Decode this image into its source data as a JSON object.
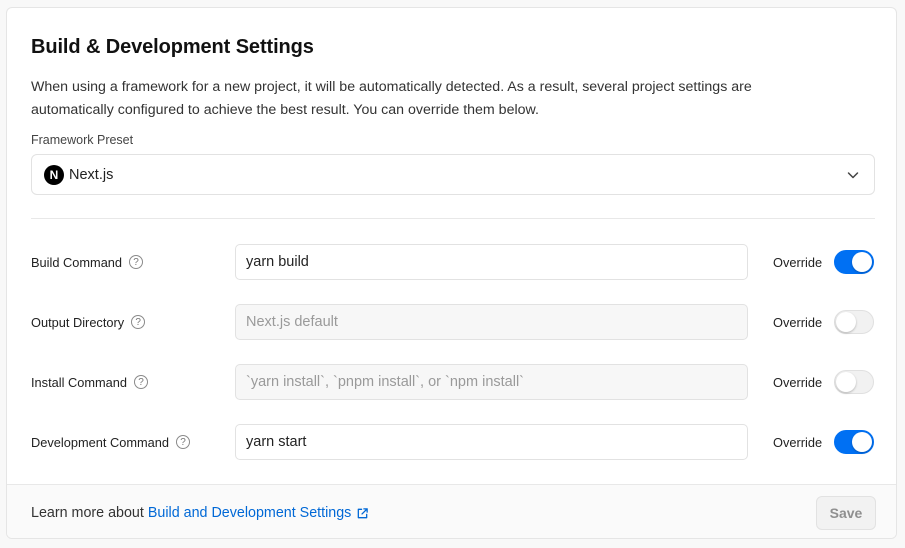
{
  "section": {
    "title": "Build & Development Settings",
    "description": "When using a framework for a new project, it will be automatically detected. As a result, several project settings are automatically configured to achieve the best result. You can override them below."
  },
  "framework": {
    "label": "Framework Preset",
    "selected": "Next.js",
    "logo_letter": "N"
  },
  "settings": [
    {
      "label": "Build Command",
      "value": "yarn build",
      "placeholder": "",
      "override_label": "Override",
      "override": true
    },
    {
      "label": "Output Directory",
      "value": "",
      "placeholder": "Next.js default",
      "override_label": "Override",
      "override": false
    },
    {
      "label": "Install Command",
      "value": "",
      "placeholder": "`yarn install`, `pnpm install`, or `npm install`",
      "override_label": "Override",
      "override": false
    },
    {
      "label": "Development Command",
      "value": "yarn start",
      "placeholder": "",
      "override_label": "Override",
      "override": true
    }
  ],
  "footer": {
    "learn_prefix": "Learn more about",
    "learn_link": "Build and Development Settings",
    "save_label": "Save"
  },
  "colors": {
    "accent": "#0070f3",
    "link": "#0068d6"
  },
  "icons": {
    "help": "question-circle-icon",
    "chevron": "chevron-down-icon",
    "external": "external-link-icon"
  }
}
